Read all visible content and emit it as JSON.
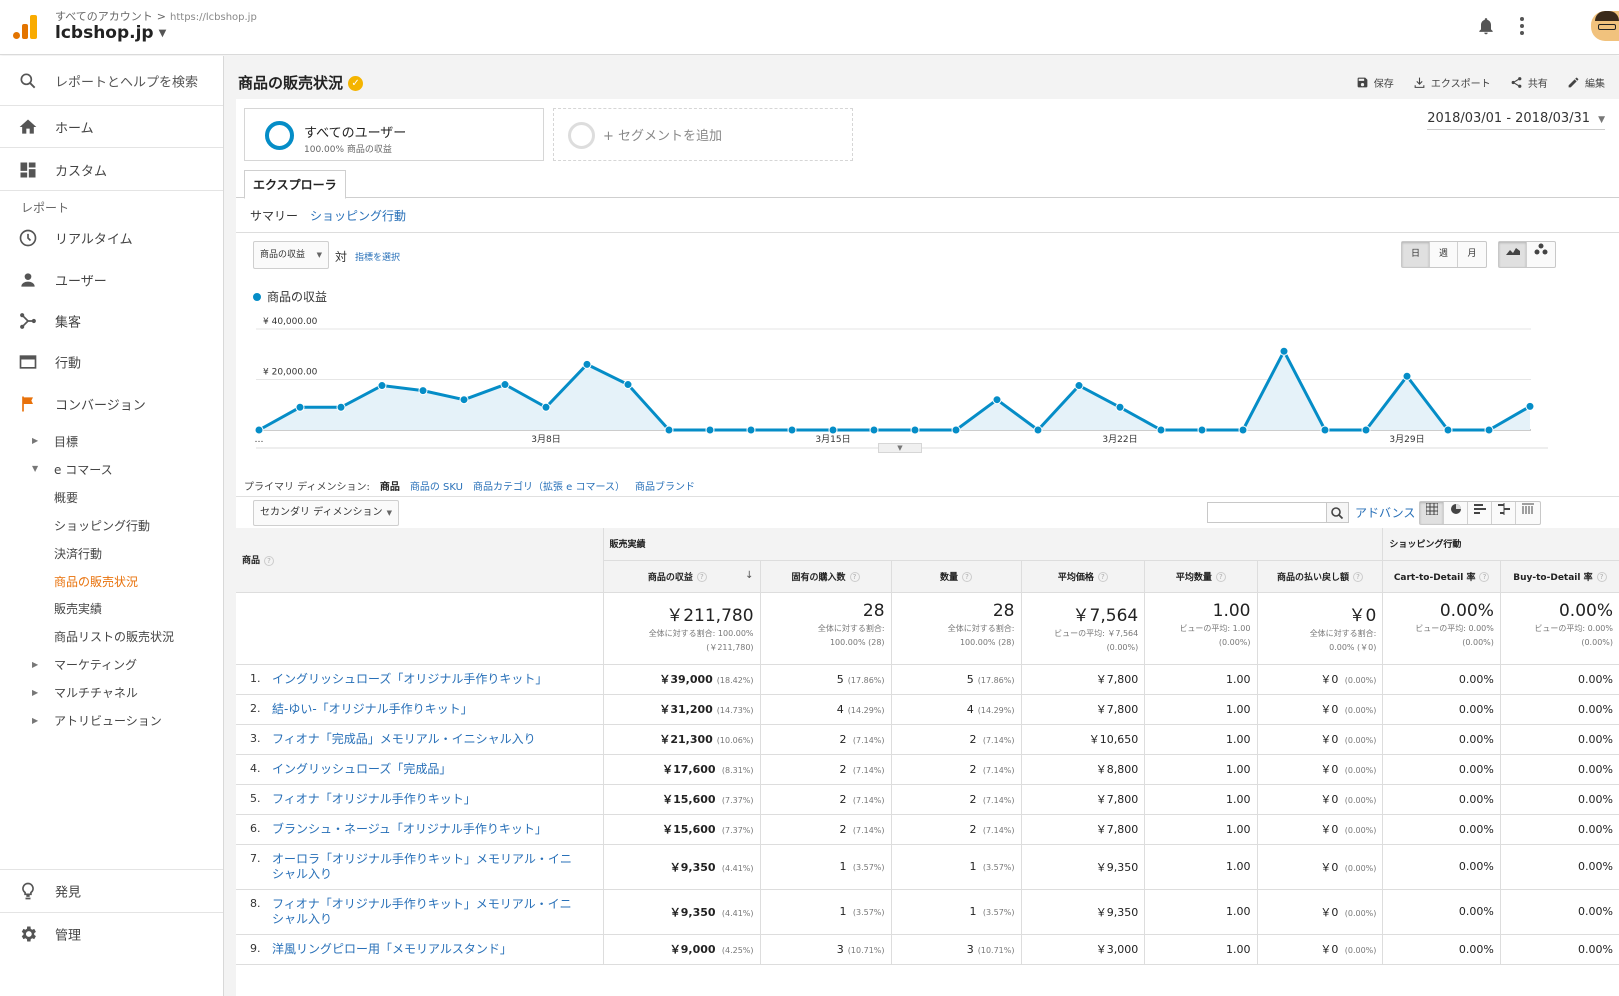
{
  "header": {
    "breadcrumb_all": "すべてのアカウント",
    "breadcrumb_sep": ">",
    "breadcrumb_url": "https://lcbshop.jp",
    "site": "lcbshop.jp"
  },
  "sidebar": {
    "search_placeholder": "レポートとヘルプを検索",
    "home": "ホーム",
    "custom": "カスタム",
    "reports_heading": "レポート",
    "realtime": "リアルタイム",
    "users": "ユーザー",
    "acquisition": "集客",
    "behavior": "行動",
    "conversion": "コンバージョン",
    "goals": "目標",
    "ecommerce": "e コマース",
    "ec_items": [
      "概要",
      "ショッピング行動",
      "決済行動",
      "商品の販売状況",
      "販売実績",
      "商品リストの販売状況"
    ],
    "ec_active_index": 3,
    "marketing": "マーケティング",
    "multichannel": "マルチチャネル",
    "attribution": "アトリビューション",
    "discover": "発見",
    "admin": "管理"
  },
  "page": {
    "title": "商品の販売状況",
    "actions": {
      "save": "保存",
      "export": "エクスポート",
      "share": "共有",
      "edit": "編集"
    },
    "date_range": "2018/03/01 - 2018/03/31",
    "segment_all": {
      "name": "すべてのユーザー",
      "sub": "100.00% 商品の収益"
    },
    "segment_add": "+ セグメントを追加",
    "tab_explorer": "エクスプローラ",
    "subtab_summary": "サマリー",
    "subtab_shopping": "ショッピング行動",
    "metric_select": "商品の収益",
    "vs": "対",
    "pick_metric": "指標を選択",
    "period_buttons": [
      "日",
      "週",
      "月"
    ],
    "primary_dim_label": "プライマリ ディメンション:",
    "primary_dims": [
      "商品",
      "商品の SKU",
      "商品カテゴリ（拡張 e コマース）",
      "商品ブランド"
    ],
    "secondary_dim": "セカンダリ ディメンション",
    "advanced": "アドバンス"
  },
  "chart_data": {
    "type": "area",
    "series": [
      {
        "name": "商品の収益",
        "values": [
          0,
          9000,
          9000,
          17600,
          15600,
          12000,
          18000,
          9000,
          26000,
          18000,
          0,
          0,
          0,
          0,
          0,
          0,
          0,
          0,
          12000,
          0,
          17600,
          9000,
          0,
          0,
          0,
          31200,
          0,
          0,
          21300,
          0,
          0,
          9350
        ]
      }
    ],
    "y_ticks": [
      "¥ 40,000.00",
      "¥ 20,000.00"
    ],
    "ylim": [
      0,
      40000
    ],
    "x_labels": [
      "…",
      "3月8日",
      "3月15日",
      "3月22日",
      "3月29日"
    ],
    "x_label_positions": [
      0,
      7,
      14,
      21,
      28
    ],
    "color": "#058dc7",
    "grid": true
  },
  "table": {
    "dim_header": "商品",
    "group_sales": "販売実績",
    "group_shopping": "ショッピング行動",
    "columns": [
      "商品の収益",
      "固有の購入数",
      "数量",
      "平均価格",
      "平均数量",
      "商品の払い戻し額",
      "Cart-to-Detail 率",
      "Buy-to-Detail 率"
    ],
    "totals": [
      {
        "main": "￥211,780",
        "sub1": "全体に対する割合: 100.00%",
        "sub2": "(￥211,780)"
      },
      {
        "main": "28",
        "sub1": "全体に対する割合:",
        "sub2": "100.00% (28)"
      },
      {
        "main": "28",
        "sub1": "全体に対する割合:",
        "sub2": "100.00% (28)"
      },
      {
        "main": "￥7,564",
        "sub1": "ビューの平均: ￥7,564",
        "sub2": "(0.00%)"
      },
      {
        "main": "1.00",
        "sub1": "ビューの平均: 1.00",
        "sub2": "(0.00%)"
      },
      {
        "main": "￥0",
        "sub1": "全体に対する割合:",
        "sub2": "0.00% (￥0)"
      },
      {
        "main": "0.00%",
        "sub1": "ビューの平均: 0.00%",
        "sub2": "(0.00%)"
      },
      {
        "main": "0.00%",
        "sub1": "ビューの平均: 0.00%",
        "sub2": "(0.00%)"
      }
    ],
    "rows": [
      {
        "n": "1.",
        "name": "イングリッシュローズ「オリジナル手作りキット」",
        "rev": "￥39,000",
        "rev_pct": "(18.42%)",
        "uniq": "5",
        "uniq_pct": "(17.86%)",
        "qty": "5",
        "qty_pct": "(17.86%)",
        "avg": "￥7,800",
        "avgq": "1.00",
        "ref": "￥0",
        "ref_pct": "(0.00%)",
        "c2d": "0.00%",
        "b2d": "0.00%"
      },
      {
        "n": "2.",
        "name": "結-ゆい-「オリジナル手作りキット」",
        "rev": "￥31,200",
        "rev_pct": "(14.73%)",
        "uniq": "4",
        "uniq_pct": "(14.29%)",
        "qty": "4",
        "qty_pct": "(14.29%)",
        "avg": "￥7,800",
        "avgq": "1.00",
        "ref": "￥0",
        "ref_pct": "(0.00%)",
        "c2d": "0.00%",
        "b2d": "0.00%"
      },
      {
        "n": "3.",
        "name": "フィオナ「完成品」メモリアル・イニシャル入り",
        "rev": "￥21,300",
        "rev_pct": "(10.06%)",
        "uniq": "2",
        "uniq_pct": "(7.14%)",
        "qty": "2",
        "qty_pct": "(7.14%)",
        "avg": "￥10,650",
        "avgq": "1.00",
        "ref": "￥0",
        "ref_pct": "(0.00%)",
        "c2d": "0.00%",
        "b2d": "0.00%"
      },
      {
        "n": "4.",
        "name": "イングリッシュローズ「完成品」",
        "rev": "￥17,600",
        "rev_pct": "(8.31%)",
        "uniq": "2",
        "uniq_pct": "(7.14%)",
        "qty": "2",
        "qty_pct": "(7.14%)",
        "avg": "￥8,800",
        "avgq": "1.00",
        "ref": "￥0",
        "ref_pct": "(0.00%)",
        "c2d": "0.00%",
        "b2d": "0.00%"
      },
      {
        "n": "5.",
        "name": "フィオナ「オリジナル手作りキット」",
        "rev": "￥15,600",
        "rev_pct": "(7.37%)",
        "uniq": "2",
        "uniq_pct": "(7.14%)",
        "qty": "2",
        "qty_pct": "(7.14%)",
        "avg": "￥7,800",
        "avgq": "1.00",
        "ref": "￥0",
        "ref_pct": "(0.00%)",
        "c2d": "0.00%",
        "b2d": "0.00%"
      },
      {
        "n": "6.",
        "name": "ブランシュ・ネージュ「オリジナル手作りキット」",
        "rev": "￥15,600",
        "rev_pct": "(7.37%)",
        "uniq": "2",
        "uniq_pct": "(7.14%)",
        "qty": "2",
        "qty_pct": "(7.14%)",
        "avg": "￥7,800",
        "avgq": "1.00",
        "ref": "￥0",
        "ref_pct": "(0.00%)",
        "c2d": "0.00%",
        "b2d": "0.00%"
      },
      {
        "n": "7.",
        "name": "オーロラ「オリジナル手作りキット」メモリアル・イニシャル入り",
        "rev": "￥9,350",
        "rev_pct": "(4.41%)",
        "uniq": "1",
        "uniq_pct": "(3.57%)",
        "qty": "1",
        "qty_pct": "(3.57%)",
        "avg": "￥9,350",
        "avgq": "1.00",
        "ref": "￥0",
        "ref_pct": "(0.00%)",
        "c2d": "0.00%",
        "b2d": "0.00%",
        "tall": true
      },
      {
        "n": "8.",
        "name": "フィオナ「オリジナル手作りキット」メモリアル・イニシャル入り",
        "rev": "￥9,350",
        "rev_pct": "(4.41%)",
        "uniq": "1",
        "uniq_pct": "(3.57%)",
        "qty": "1",
        "qty_pct": "(3.57%)",
        "avg": "￥9,350",
        "avgq": "1.00",
        "ref": "￥0",
        "ref_pct": "(0.00%)",
        "c2d": "0.00%",
        "b2d": "0.00%",
        "tall": true
      },
      {
        "n": "9.",
        "name": "洋風リングピロー用「メモリアルスタンド」",
        "rev": "￥9,000",
        "rev_pct": "(4.25%)",
        "uniq": "3",
        "uniq_pct": "(10.71%)",
        "qty": "3",
        "qty_pct": "(10.71%)",
        "avg": "￥3,000",
        "avgq": "1.00",
        "ref": "￥0",
        "ref_pct": "(0.00%)",
        "c2d": "0.00%",
        "b2d": "0.00%"
      }
    ]
  }
}
